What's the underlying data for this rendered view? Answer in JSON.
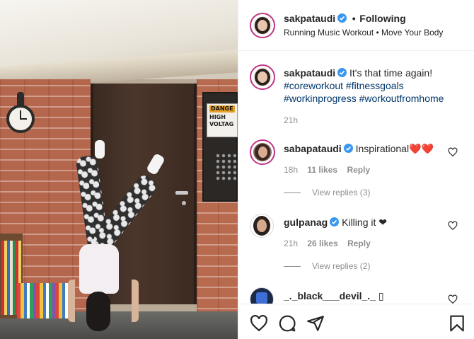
{
  "header": {
    "username": "sakpataudi",
    "separator": "•",
    "follow_status": "Following",
    "subtitle": "Running Music Workout • Move Your Body"
  },
  "caption": {
    "username": "sakpataudi",
    "text": "It's that time again!",
    "hashtags_line1": "#coreworkout #fitnessgoals",
    "hashtags_line2": "#workinprogress #workoutfromhome",
    "time": "21h"
  },
  "comments": [
    {
      "username": "sabapataudi",
      "text": "Inspirational❤️❤️",
      "time": "18h",
      "likes": "11 likes",
      "reply_label": "Reply",
      "view_replies": "View replies (3)"
    },
    {
      "username": "gulpanag",
      "text": "Killing it ❤",
      "time": "21h",
      "likes": "26 likes",
      "reply_label": "Reply",
      "view_replies": "View replies (2)"
    },
    {
      "username": "_._black___devil_._",
      "text": "▯"
    }
  ],
  "media": {
    "sign_tag": "DANGE",
    "sign_line1": "HIGH",
    "sign_line2": "VOLTAG"
  },
  "icons": {
    "verified": "verified-badge-icon",
    "like": "heart-icon",
    "comment": "comment-icon",
    "share": "share-icon",
    "save": "bookmark-icon"
  },
  "colors": {
    "verified_blue": "#3897f0",
    "hashtag": "#00376b",
    "meta_gray": "#8e8e8e",
    "story_ring": "#c13584"
  }
}
